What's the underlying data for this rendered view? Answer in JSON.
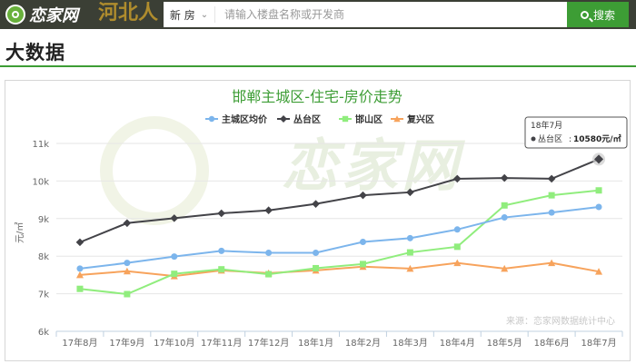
{
  "header": {
    "logo_text": "恋家网",
    "banner_text": "河北人",
    "search_type": "新 房",
    "search_placeholder": "请输入楼盘名称或开发商",
    "search_button": "搜索"
  },
  "page": {
    "section_title": "大数据"
  },
  "tooltip": {
    "title": "18年7月",
    "series": "丛台区",
    "value": "10580元/㎡"
  },
  "chart_data": {
    "type": "line",
    "title": "邯郸主城区-住宅-房价走势",
    "ylabel": "元/㎡",
    "ylim": [
      6000,
      11000
    ],
    "yticks": [
      6000,
      7000,
      8000,
      9000,
      10000,
      11000
    ],
    "ytick_labels": [
      "6k",
      "7k",
      "8k",
      "9k",
      "10k",
      "11k"
    ],
    "grid": "horizontal",
    "legend_position": "top-center",
    "source": "来源：恋家网数据统计中心",
    "categories": [
      "17年8月",
      "17年9月",
      "17年10月",
      "17年11月",
      "17年12月",
      "18年1月",
      "18年2月",
      "18年3月",
      "18年4月",
      "18年5月",
      "18年6月",
      "18年7月"
    ],
    "series": [
      {
        "name": "主城区均价",
        "color": "#7cb5ec",
        "marker": "circle",
        "values": [
          7670,
          7820,
          7990,
          8140,
          8090,
          8090,
          8380,
          8480,
          8710,
          9030,
          9160,
          9310
        ]
      },
      {
        "name": "丛台区",
        "color": "#434348",
        "marker": "diamond",
        "values": [
          8370,
          8880,
          9010,
          9140,
          9220,
          9390,
          9620,
          9700,
          10060,
          10080,
          10060,
          10580
        ]
      },
      {
        "name": "邯山区",
        "color": "#90ed7d",
        "marker": "square",
        "values": [
          7130,
          6990,
          7530,
          7650,
          7520,
          7680,
          7790,
          8100,
          8250,
          9350,
          9620,
          9750
        ]
      },
      {
        "name": "复兴区",
        "color": "#f7a35c",
        "marker": "triangle",
        "values": [
          7500,
          7600,
          7470,
          7620,
          7550,
          7620,
          7720,
          7670,
          7820,
          7670,
          7820,
          7590
        ]
      }
    ]
  }
}
